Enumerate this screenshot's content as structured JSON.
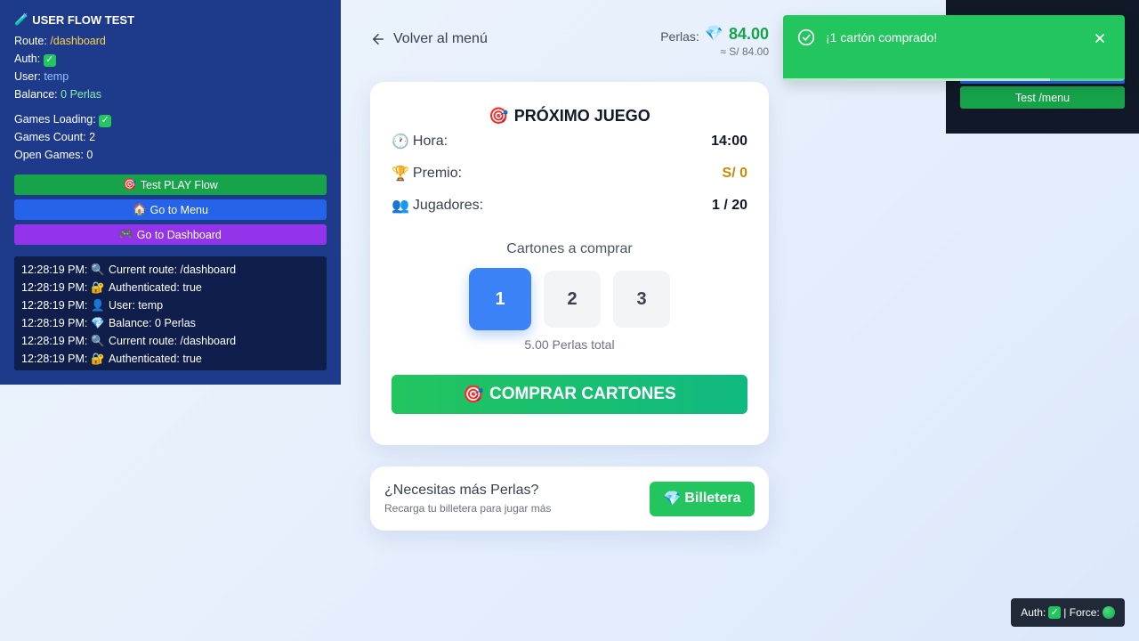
{
  "debug": {
    "title": "USER FLOW TEST",
    "route_label": "Route:",
    "route_value": "/dashboard",
    "auth_label": "Auth:",
    "user_label": "User:",
    "user_value": "temp",
    "balance_label": "Balance:",
    "balance_value": "0 Perlas",
    "games_loading_label": "Games Loading:",
    "games_count_label": "Games Count:",
    "games_count_value": "2",
    "open_games_label": "Open Games:",
    "open_games_value": "0",
    "buttons": {
      "test_play": "Test PLAY Flow",
      "go_menu": "Go to Menu",
      "go_dashboard": "Go to Dashboard"
    },
    "log": [
      {
        "time": "12:28:19 PM:",
        "icon": "magnifier-icon",
        "text": "Current route: /dashboard"
      },
      {
        "time": "12:28:19 PM:",
        "icon": "lock-icon",
        "text": "Authenticated: true"
      },
      {
        "time": "12:28:19 PM:",
        "icon": "user-icon",
        "text": "User: temp"
      },
      {
        "time": "12:28:19 PM:",
        "icon": "gem-icon",
        "text": "Balance: 0 Perlas"
      },
      {
        "time": "12:28:19 PM:",
        "icon": "magnifier-icon",
        "text": "Current route: /dashboard"
      },
      {
        "time": "12:28:19 PM:",
        "icon": "lock-icon",
        "text": "Authenticated: true"
      }
    ]
  },
  "nav": {
    "back_label": "Volver al menú",
    "balance_label": "Perlas:",
    "balance_value": "84.00",
    "balance_sub": "≈ S/ 84.00"
  },
  "game": {
    "title": "PRÓXIMO JUEGO",
    "hora_label": "Hora:",
    "hora_value": "14:00",
    "premio_label": "Premio:",
    "premio_value": "S/ 0",
    "jugadores_label": "Jugadores:",
    "jugadores_value": "1 / 20",
    "qty_title": "Cartones a comprar",
    "qty_options": [
      "1",
      "2",
      "3"
    ],
    "qty_selected": "1",
    "qty_total": "5.00 Perlas total",
    "buy_label": "COMPRAR CARTONES"
  },
  "wallet": {
    "title": "¿Necesitas más Perlas?",
    "subtitle": "Recarga tu billetera para jugar más",
    "button": "Billetera"
  },
  "right_panel": {
    "test_menu": "Test /menu"
  },
  "toast": {
    "message": "¡1 cartón comprado!",
    "progress": 0.78
  },
  "badge": {
    "auth_label": "Auth:",
    "force_label": "| Force:"
  },
  "colors": {
    "accent_blue": "#3b82f6",
    "success_green": "#22c55e",
    "debug_navy": "#1e3a8a",
    "prize_gold": "#ca8a04"
  }
}
